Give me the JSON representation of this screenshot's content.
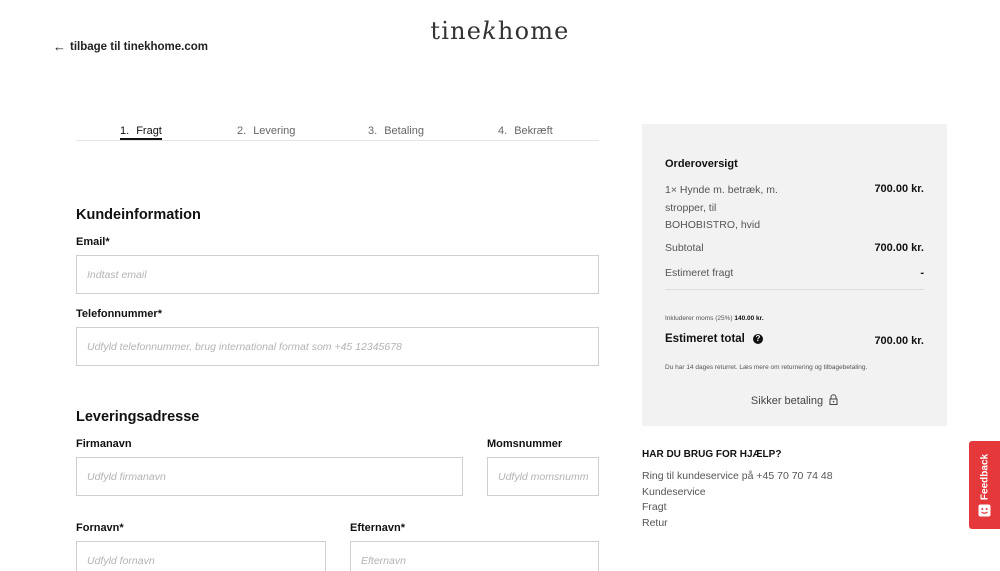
{
  "header": {
    "back_arrow": "←",
    "back_link": "tilbage til tinekhome.com",
    "logo_part1": "tine",
    "logo_k": "k",
    "logo_part2": "home"
  },
  "steps": [
    {
      "num": "1.",
      "label": "Fragt",
      "active": true
    },
    {
      "num": "2.",
      "label": "Levering",
      "active": false
    },
    {
      "num": "3.",
      "label": "Betaling",
      "active": false
    },
    {
      "num": "4.",
      "label": "Bekræft",
      "active": false
    }
  ],
  "customer": {
    "title": "Kundeinformation",
    "email_label": "Email*",
    "email_placeholder": "Indtast email",
    "phone_label": "Telefonnummer*",
    "phone_placeholder": "Udfyld telefonnummer, brug international format som +45 12345678"
  },
  "delivery": {
    "title": "Leveringsadresse",
    "company_label": "Firmanavn",
    "company_placeholder": "Udfyld firmanavn",
    "vat_label": "Momsnummer",
    "vat_placeholder": "Udfyld momsnummer",
    "firstname_label": "Fornavn*",
    "firstname_placeholder": "Udfyld fornavn",
    "lastname_label": "Efternavn*",
    "lastname_placeholder": "Efternavn"
  },
  "summary": {
    "title": "Orderoversigt",
    "item_line1": "1× Hynde m. betræk, m.",
    "item_line2": "stropper, til",
    "item_line3": "BOHOBISTRO, hvid",
    "item_price": "700.00 kr.",
    "subtotal_label": "Subtotal",
    "subtotal_value": "700.00 kr.",
    "shipping_label": "Estimeret fragt",
    "shipping_value": "-",
    "vat_text": "Inkluderer moms (25%)",
    "vat_value": "140.00 kr.",
    "total_label": "Estimeret total",
    "total_help_icon": "?",
    "total_value": "700.00 kr.",
    "return_note": "Du har 14 dages returret. Læs mere om returnering og tilbagebetaling.",
    "secure_label": "Sikker betaling"
  },
  "help": {
    "title": "HAR DU BRUG FOR HJÆLP?",
    "phone_line": "Ring til kundeservice på +45 70 70 74 48",
    "links": [
      "Kundeservice",
      "Fragt",
      "Retur"
    ]
  },
  "feedback": {
    "label": "Feedback",
    "color": "#e5383b"
  }
}
